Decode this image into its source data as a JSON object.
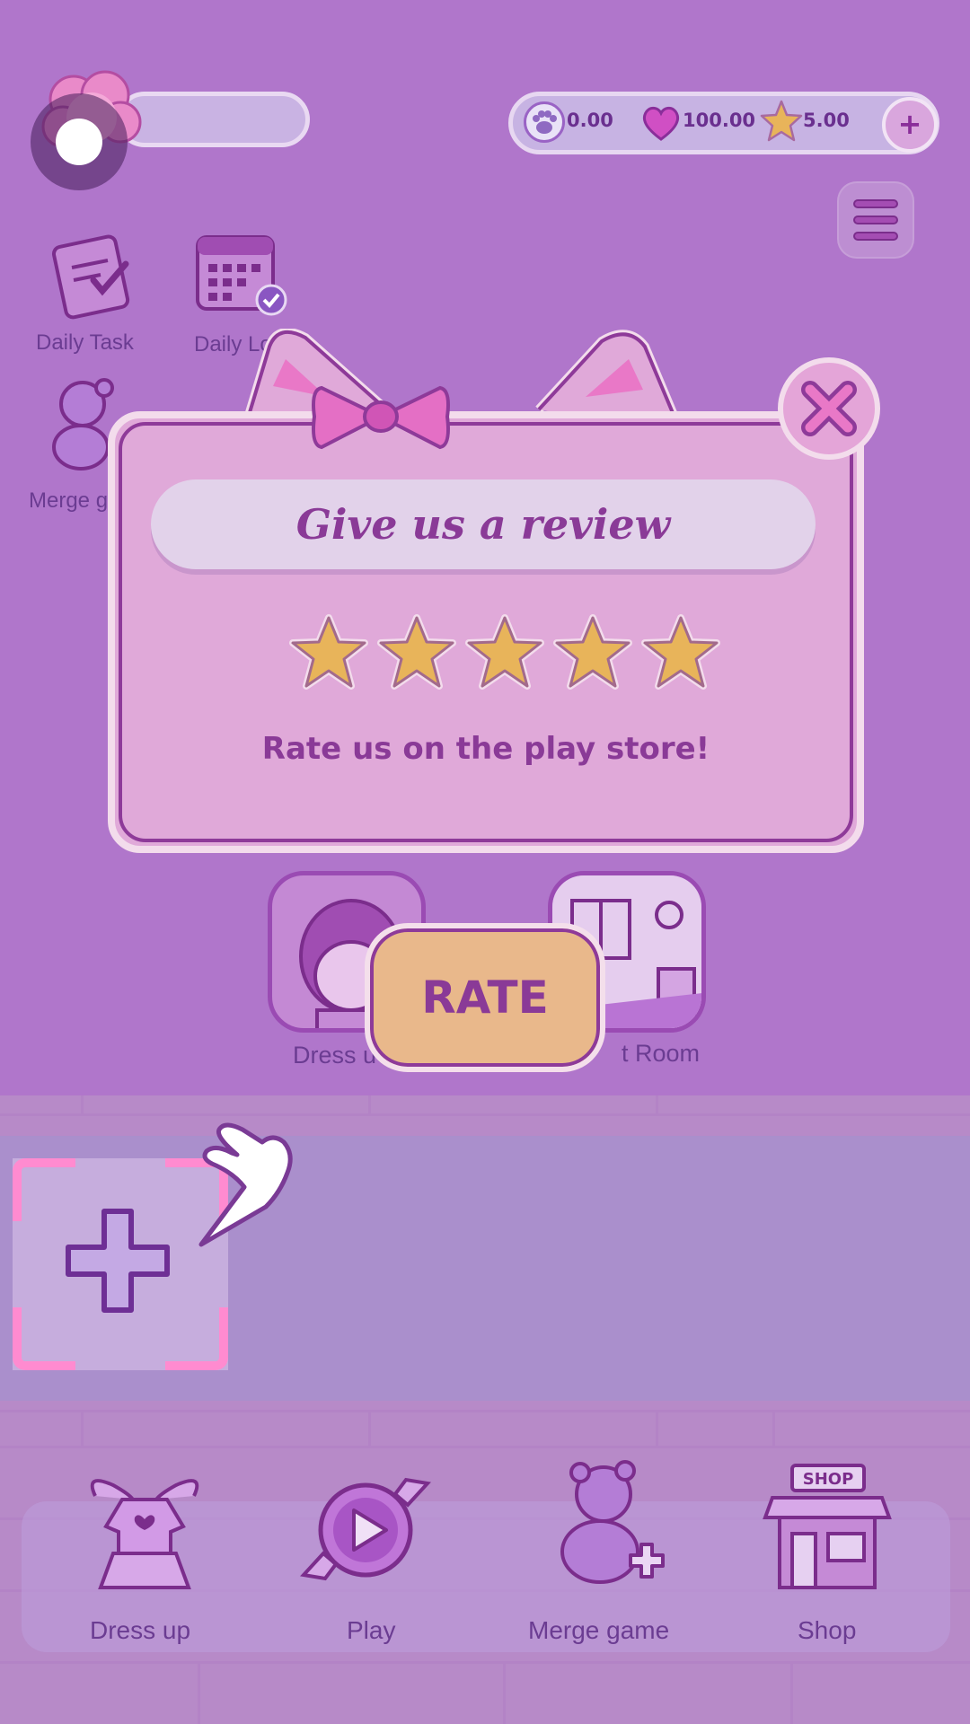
{
  "hud": {
    "paw_value": "0.00",
    "heart_value": "100.00",
    "star_value": "5.00",
    "add_label": "+"
  },
  "shortcuts": {
    "daily_task": "Daily Task",
    "daily_log": "Daily Log",
    "merge_partial": "Merge g"
  },
  "modal": {
    "title": "Give us a review",
    "subtitle": "Rate us on the play store!",
    "rating_stars": 5,
    "rate_button": "RATE"
  },
  "tiles": {
    "left_label": "Dress u",
    "right_label": "t Room"
  },
  "bottom_nav": {
    "items": [
      {
        "label": "Dress up",
        "icon": "dress-icon"
      },
      {
        "label": "Play",
        "icon": "candy-play-icon"
      },
      {
        "label": "Merge game",
        "icon": "teddy-plus-icon"
      },
      {
        "label": "Shop",
        "icon": "shop-icon"
      }
    ]
  },
  "colors": {
    "background": "#b076cb",
    "modal_pink": "#e0a9d9",
    "accent_purple": "#8a3a97",
    "rate_button": "#e9b88b",
    "star_gold": "#e8b45a",
    "slot_corner_pink": "#ff8bd0"
  }
}
